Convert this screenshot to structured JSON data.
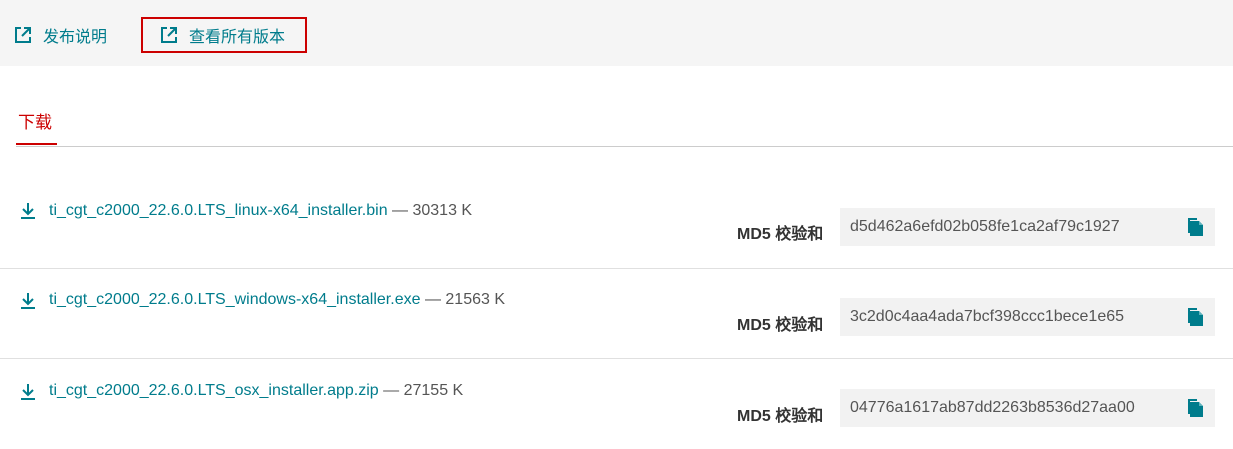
{
  "header": {
    "release_notes_label": "发布说明",
    "all_versions_label": "查看所有版本"
  },
  "tabs": {
    "download_label": "下载"
  },
  "md5_label": "MD5 校验和",
  "downloads": [
    {
      "filename": "ti_cgt_c2000_22.6.0.LTS_linux-x64_installer.bin",
      "size": " — 30313 K",
      "md5": "d5d462a6efd02b058fe1ca2af79c1927"
    },
    {
      "filename": "ti_cgt_c2000_22.6.0.LTS_windows-x64_installer.exe",
      "size": " — 21563 K",
      "md5": "3c2d0c4aa4ada7bcf398ccc1bece1e65"
    },
    {
      "filename": "ti_cgt_c2000_22.6.0.LTS_osx_installer.app.zip",
      "size": " — 27155 K",
      "md5": "04776a1617ab87dd2263b8536d27aa00"
    }
  ],
  "colors": {
    "accent_link": "#007c8c",
    "active_tab": "#cc0000",
    "highlight_border": "#cc0000"
  },
  "icons": {
    "external_link": "external-link-icon",
    "download": "download-icon",
    "copy": "copy-icon"
  }
}
